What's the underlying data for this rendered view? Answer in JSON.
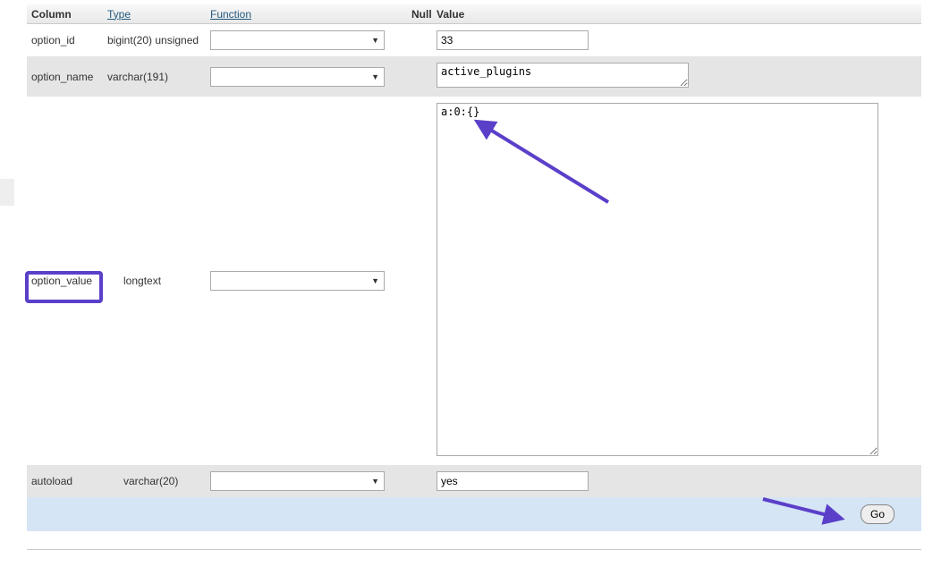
{
  "headers": {
    "column": "Column",
    "type": "Type",
    "function": "Function",
    "null": "Null",
    "value": "Value"
  },
  "rows": [
    {
      "column": "option_id",
      "type": "bigint(20) unsigned",
      "value": "33"
    },
    {
      "column": "option_name",
      "type": "varchar(191)",
      "value": "active_plugins"
    },
    {
      "column": "option_value",
      "type": "longtext",
      "value": "a:0:{}"
    },
    {
      "column": "autoload",
      "type": "varchar(20)",
      "value": "yes"
    }
  ],
  "buttons": {
    "go": "Go"
  }
}
